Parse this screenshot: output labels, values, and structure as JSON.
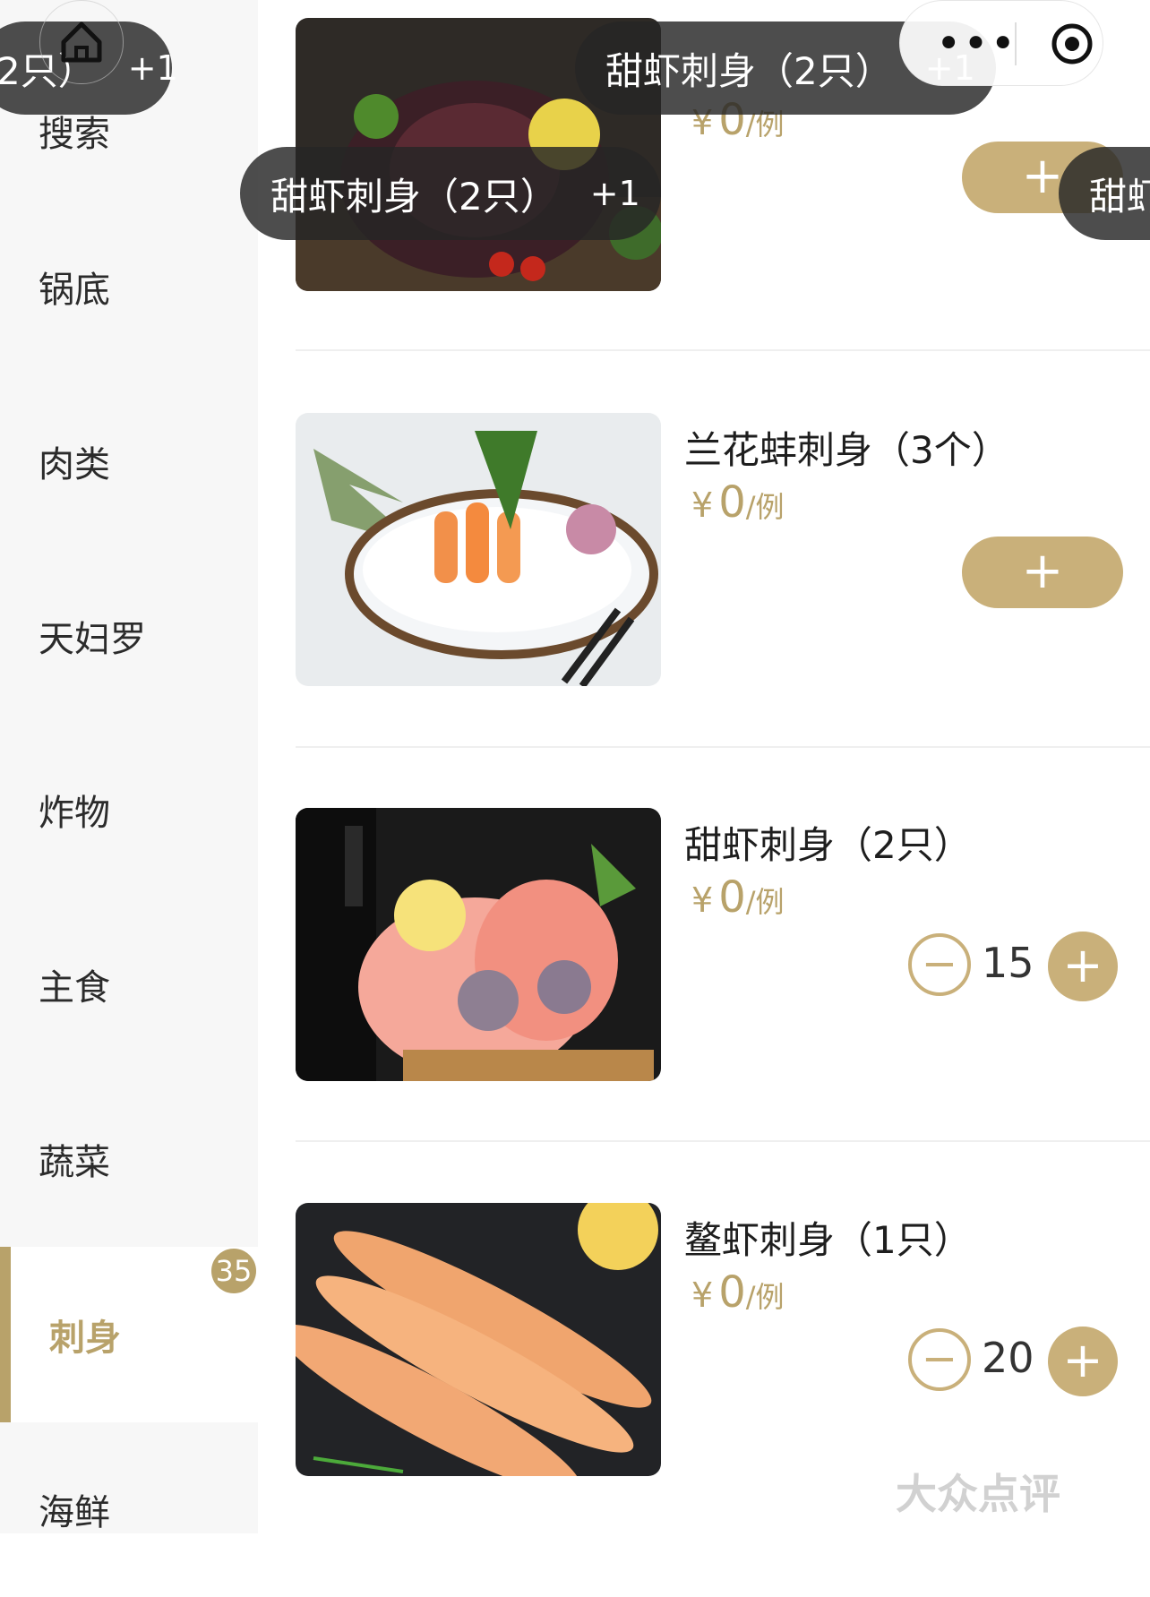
{
  "sidebar": {
    "categories": [
      {
        "label": "搜索"
      },
      {
        "label": "锅底"
      },
      {
        "label": "肉类"
      },
      {
        "label": "天妇罗"
      },
      {
        "label": "炸物"
      },
      {
        "label": "主食"
      },
      {
        "label": "蔬菜"
      },
      {
        "label": "刺身",
        "active": true,
        "badge": "35"
      },
      {
        "label": "海鲜"
      }
    ]
  },
  "dishes": [
    {
      "name": "",
      "price": {
        "currency": "¥",
        "amount": "0",
        "unit": "/例"
      },
      "action": "+"
    },
    {
      "name": "兰花蚌刺身（3个）",
      "price": {
        "currency": "¥",
        "amount": "0",
        "unit": "/例"
      },
      "action": "+"
    },
    {
      "name": "甜虾刺身（2只）",
      "price": {
        "currency": "¥",
        "amount": "0",
        "unit": "/例"
      },
      "quantity": "15",
      "minus": "−",
      "plus": "+"
    },
    {
      "name": "鳌虾刺身（1只）",
      "price": {
        "currency": "¥",
        "amount": "0",
        "unit": "/例"
      },
      "quantity": "20",
      "minus": "−",
      "plus": "+"
    }
  ],
  "toasts": [
    {
      "text": "2只）",
      "increment": "+1"
    },
    {
      "text": "甜虾刺身（2只）",
      "increment": "+1"
    },
    {
      "text": "甜虾刺身（2只）",
      "increment": "+1"
    },
    {
      "text": "甜虾",
      "increment": ""
    }
  ],
  "capsule": {
    "menu_icon": "more-dots-icon",
    "close_icon": "target-icon"
  },
  "nav": {
    "home_icon": "home-icon"
  },
  "watermark": "大众点评",
  "colors": {
    "accent": "#b8a26a",
    "button": "#c9b07a",
    "toast_bg": "#262626"
  }
}
